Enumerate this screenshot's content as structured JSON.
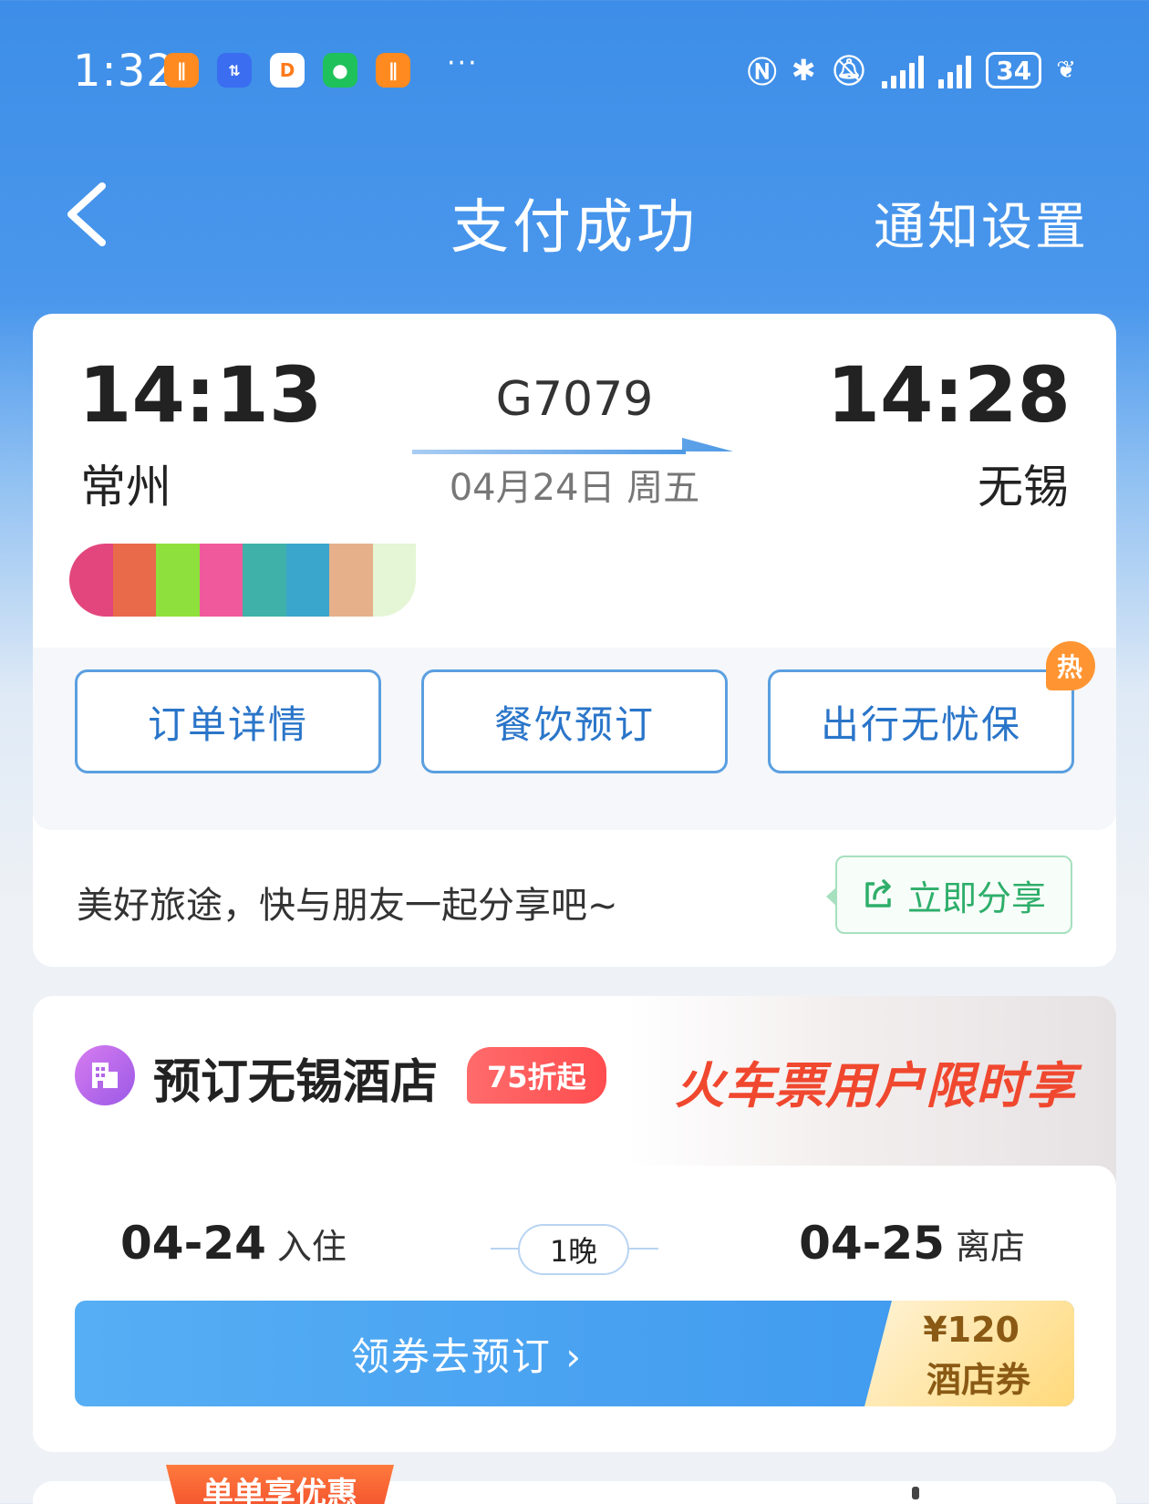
{
  "status_bar": {
    "time": "1:32",
    "more": "···",
    "battery": "34",
    "app_icons": [
      "taobao-icon",
      "app-icon",
      "didi-icon",
      "wechat-icon",
      "taobao-icon"
    ],
    "accent": "#3d8ee8"
  },
  "nav": {
    "title": "支付成功",
    "right_action": "通知设置"
  },
  "trip": {
    "departure_time": "14:13",
    "departure_city": "常州",
    "train_number": "G7079",
    "date": "04月24日 周五",
    "arrival_time": "14:28",
    "arrival_city": "无锡"
  },
  "actions": [
    {
      "label": "订单详情"
    },
    {
      "label": "餐饮预订"
    },
    {
      "label": "出行无忧保",
      "badge": "热"
    }
  ],
  "share": {
    "text": "美好旅途，快与朋友一起分享吧~",
    "button": "立即分享"
  },
  "hotel": {
    "title": "预订无锡酒店",
    "discount": "75折起",
    "promo": "火车票用户限时享",
    "checkin_date": "04-24",
    "checkin_label": "入住",
    "nights": "1晚",
    "checkout_date": "04-25",
    "checkout_label": "离店",
    "cta": "领券去预订 ›",
    "coupon_amount": "¥120",
    "coupon_desc": "酒店券"
  },
  "bottom": {
    "ribbon": "单单享优惠"
  }
}
